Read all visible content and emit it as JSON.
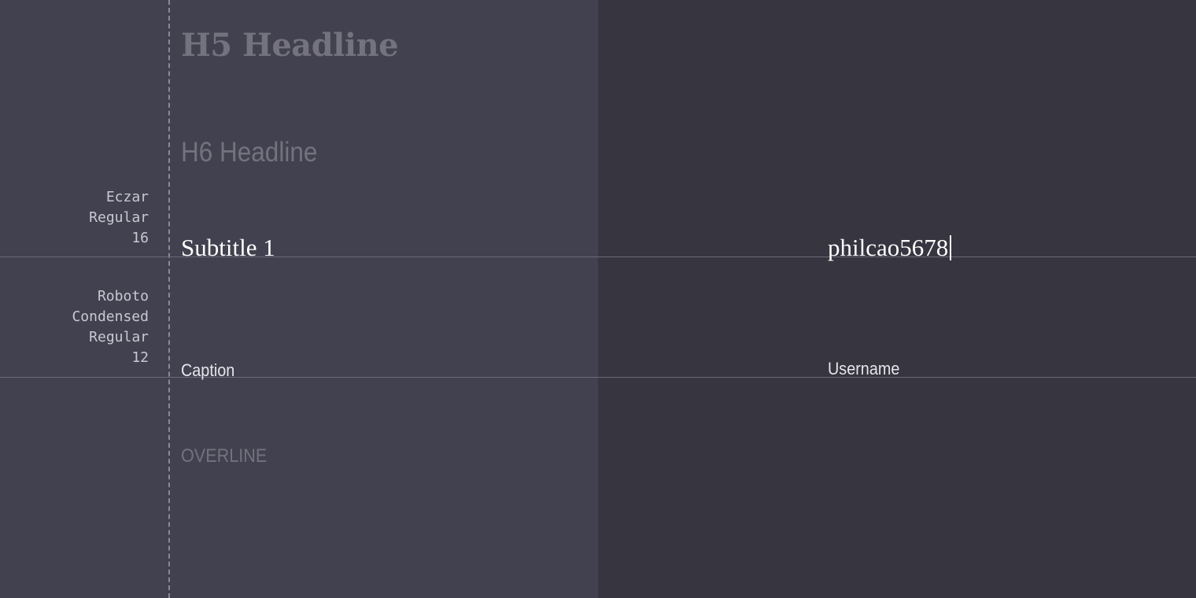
{
  "specs": {
    "serif_spec": [
      "Eczar",
      "Regular",
      "16"
    ],
    "condensed_spec": [
      "Roboto",
      "Condensed",
      "Regular",
      "12"
    ]
  },
  "samples": {
    "h5": "H5 Headline",
    "h6": "H6 Headline",
    "subtitle1": "Subtitle 1",
    "caption": "Caption",
    "overline": "OVERLINE"
  },
  "field": {
    "value": "philcao5678",
    "label": "Username"
  },
  "colors": {
    "left_background": "#42414f",
    "right_background": "#363540",
    "muted_text": "#73727e",
    "primary_text": "#ffffff"
  }
}
